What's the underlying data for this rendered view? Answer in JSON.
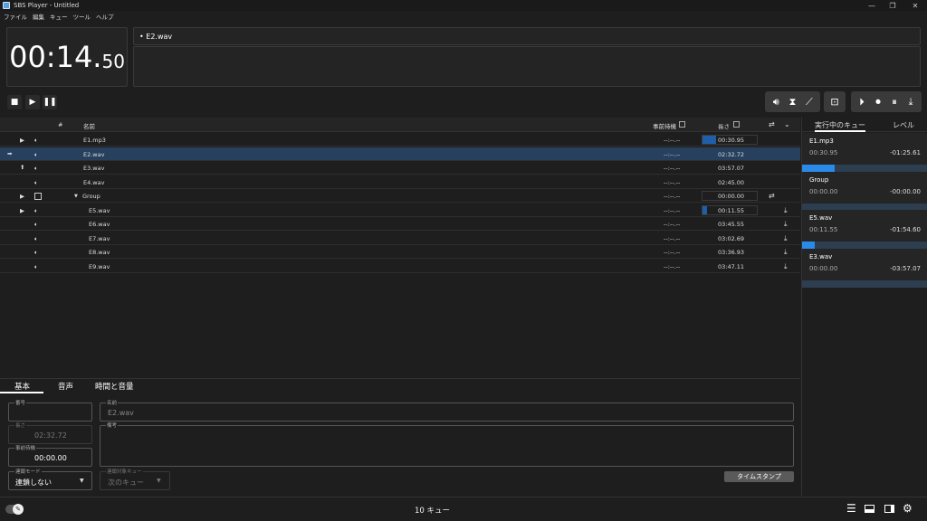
{
  "window": {
    "title": "SBS Player - Untitled"
  },
  "menu": [
    "ファイル",
    "編集",
    "キュー",
    "ツール",
    "ヘルプ"
  ],
  "timer": {
    "main": "00:14.",
    "fraction": "50"
  },
  "current_cue": "• E2.wav",
  "table": {
    "headers": {
      "num": "#",
      "name": "名前",
      "prewait": "事前待機",
      "length": "長さ"
    },
    "rows": [
      {
        "name": "E1.mp3",
        "prewait": "--:--.--",
        "length": "00:30.95",
        "status": "play",
        "fill": 0.25
      },
      {
        "name": "E2.wav",
        "prewait": "--:--.--",
        "length": "02:32.72",
        "status": "arrow",
        "selected": true
      },
      {
        "name": "E3.wav",
        "prewait": "--:--.--",
        "length": "03:57.07",
        "status": "up"
      },
      {
        "name": "E4.wav",
        "prewait": "--:--.--",
        "length": "02:45.00",
        "status": ""
      },
      {
        "name": "Group",
        "prewait": "--:--.--",
        "length": "00:00.00",
        "status": "play",
        "group": true
      },
      {
        "name": "E5.wav",
        "prewait": "--:--.--",
        "length": "00:11.55",
        "status": "play",
        "child": true,
        "fill": 0.08
      },
      {
        "name": "E6.wav",
        "prewait": "--:--.--",
        "length": "03:45.55",
        "status": "",
        "child": true
      },
      {
        "name": "E7.wav",
        "prewait": "--:--.--",
        "length": "03:02.69",
        "status": "",
        "child": true
      },
      {
        "name": "E8.wav",
        "prewait": "--:--.--",
        "length": "03:36.93",
        "status": "",
        "child": true
      },
      {
        "name": "E9.wav",
        "prewait": "--:--.--",
        "length": "03:47.11",
        "status": "",
        "child": true
      }
    ]
  },
  "right_panel": {
    "tabs": [
      "実行中のキュー",
      "レベル"
    ],
    "cards": [
      {
        "name": "E1.mp3",
        "elapsed": "00:30.95",
        "remaining": "-01:25.61",
        "progress": 0.26
      },
      {
        "name": "Group",
        "elapsed": "00:00.00",
        "remaining": "-00:00.00",
        "progress": 0
      },
      {
        "name": "E5.wav",
        "elapsed": "00:11.55",
        "remaining": "-01:54.60",
        "progress": 0.1
      },
      {
        "name": "E3.wav",
        "elapsed": "00:00.00",
        "remaining": "-03:57.07",
        "progress": 0
      }
    ]
  },
  "bottom": {
    "tabs": [
      "基本",
      "音声",
      "時間と音量"
    ],
    "fields": {
      "number_label": "番号",
      "number_value": "",
      "length_label": "長さ",
      "length_value": "02:32.72",
      "prewait_label": "事前待機",
      "prewait_value": "00:00.00",
      "chain_label": "連鎖モード",
      "chain_value": "連鎖しない",
      "name_label": "名前",
      "name_value": "E2.wav",
      "notes_label": "備考",
      "target_label": "連鎖対象キュー",
      "target_value": "次のキュー"
    },
    "timestamp_button": "タイムスタンプ"
  },
  "status": {
    "cue_count": "10 キュー"
  }
}
